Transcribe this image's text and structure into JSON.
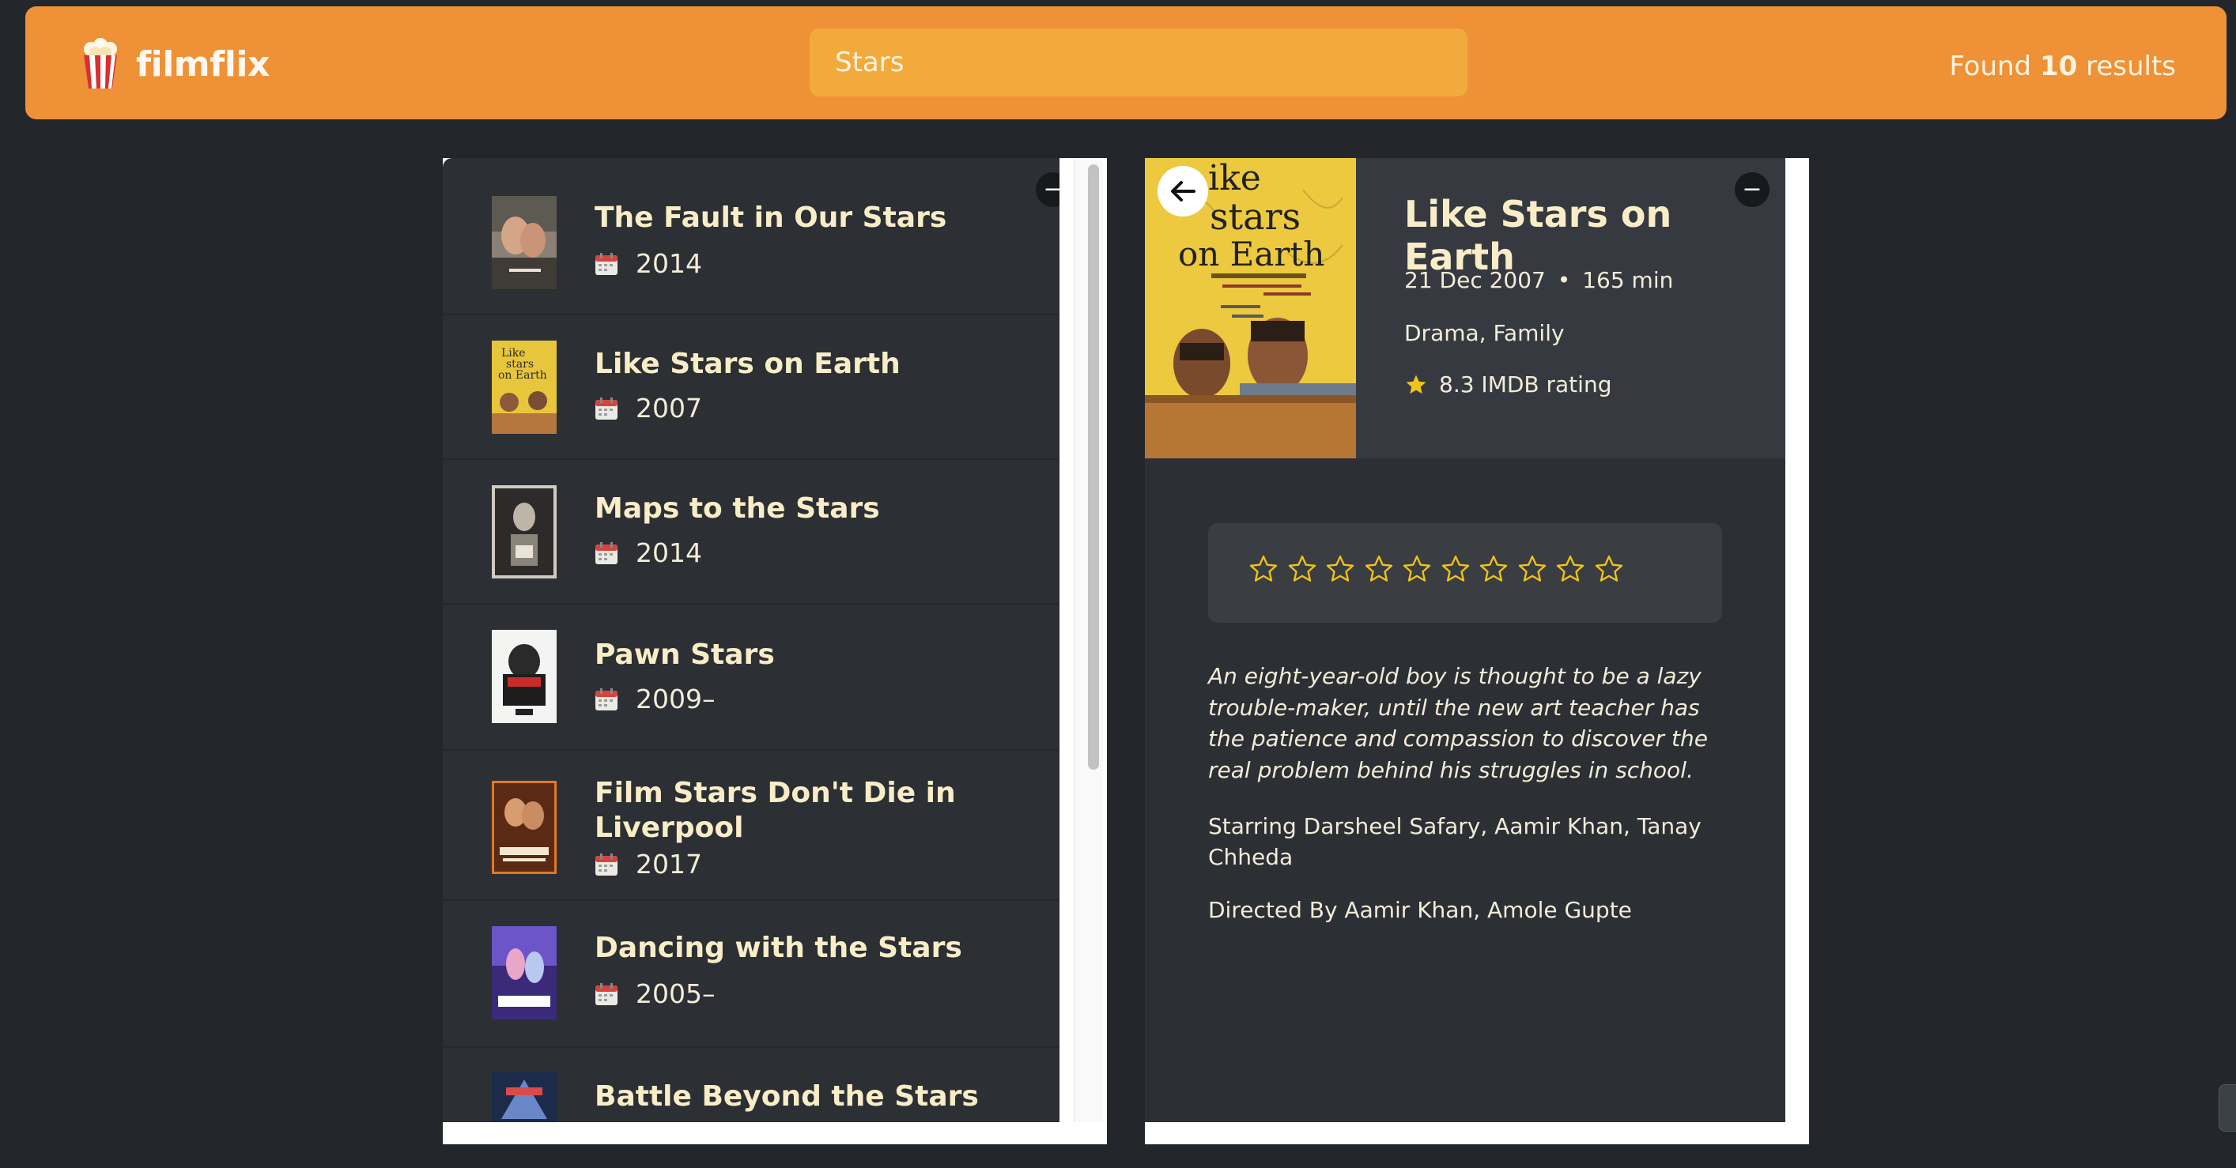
{
  "app": {
    "name": "filmflix",
    "logo_icon": "popcorn-icon"
  },
  "search": {
    "value": "Stars",
    "placeholder": "Search"
  },
  "results": {
    "prefix": "Found",
    "count": "10",
    "suffix": "results"
  },
  "list": {
    "items": [
      {
        "title": "The Fault in Our Stars",
        "year": "2014"
      },
      {
        "title": "Like Stars on Earth",
        "year": "2007"
      },
      {
        "title": "Maps to the Stars",
        "year": "2014"
      },
      {
        "title": "Pawn Stars",
        "year": "2009–"
      },
      {
        "title": "Film Stars Don't Die in Liverpool",
        "year": "2017"
      },
      {
        "title": "Dancing with the Stars",
        "year": "2005–"
      },
      {
        "title": "Battle Beyond the Stars",
        "year": ""
      }
    ]
  },
  "detail": {
    "title": "Like Stars on Earth",
    "release": "21 Dec 2007",
    "separator": "•",
    "runtime": "165 min",
    "genre": "Drama, Family",
    "rating": "8.3 IMDB rating",
    "poster_text": {
      "line1": "ike",
      "line2": "stars",
      "line3": "on Earth"
    },
    "user_rating": 0,
    "user_rating_max": 10,
    "plot": "An eight-year-old boy is thought to be a lazy trouble-maker, until the new art teacher has the patience and compassion to discover the real problem behind his struggles in school.",
    "cast": "Starring Darsheel Safary, Aamir Khan, Tanay Chheda",
    "director": "Directed By Aamir Khan, Amole Gupte"
  },
  "colors": {
    "header": "#ef9136",
    "search_bg": "#f2aa3c",
    "background": "#23272b",
    "panel": "#2c2f34",
    "accent_text": "#f8edc7",
    "star": "#f0c419"
  }
}
